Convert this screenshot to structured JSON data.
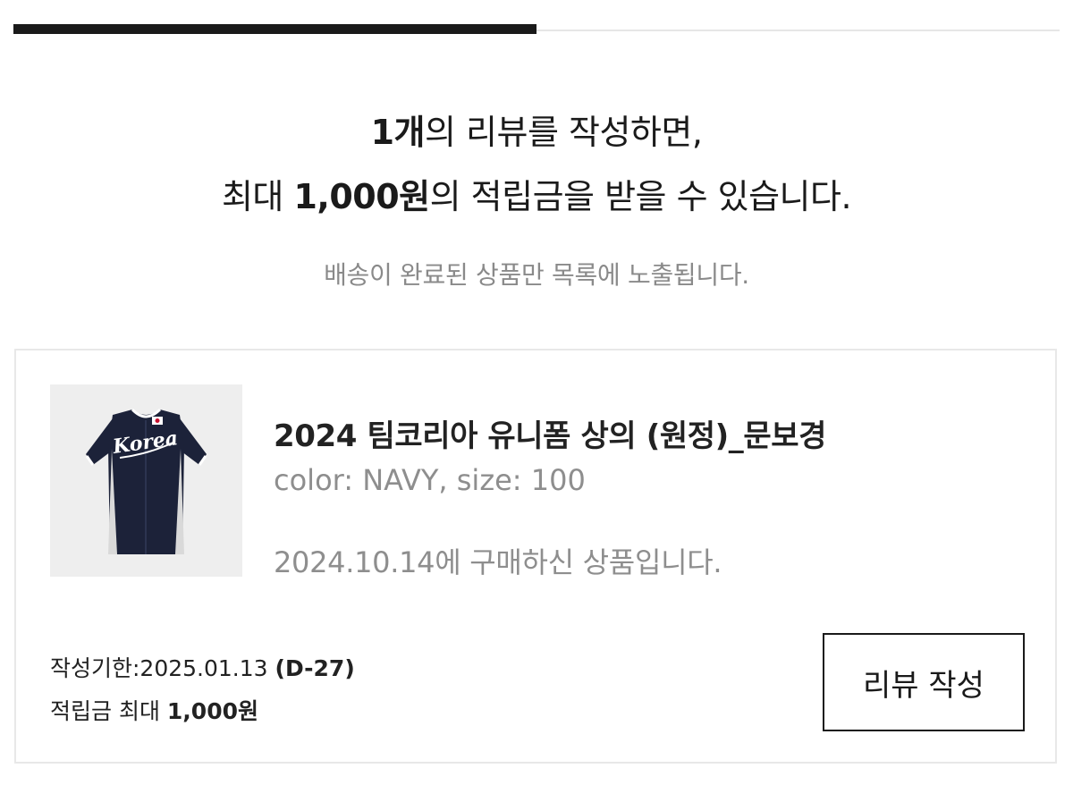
{
  "tabs": {
    "active_fraction": 0.5
  },
  "headline": {
    "line1_count": "1개",
    "line1_rest": "의 리뷰를 작성하면,",
    "line2_prefix": "최대 ",
    "line2_amount": "1,000원",
    "line2_rest": "의 적립금을 받을 수 있습니다."
  },
  "subnote": "배송이 완료된 상품만 목록에 노출됩니다.",
  "review_item": {
    "product_image": {
      "icon": "jersey-image",
      "text": "Korea",
      "colors": {
        "body": "#1c2239",
        "trim": "#ffffff",
        "background": "#eeeeee"
      }
    },
    "product_name": "2024 팀코리아 유니폼 상의 (원정)_문보경",
    "option": "color: NAVY, size: 100",
    "purchase_info": "2024.10.14에 구매하신 상품입니다.",
    "deadline_label": "작성기한:2025.01.13 ",
    "deadline_dday": "(D-27)",
    "reward_label": "적립금 최대 ",
    "reward_amount": "1,000원",
    "button_label": "리뷰 작성"
  }
}
